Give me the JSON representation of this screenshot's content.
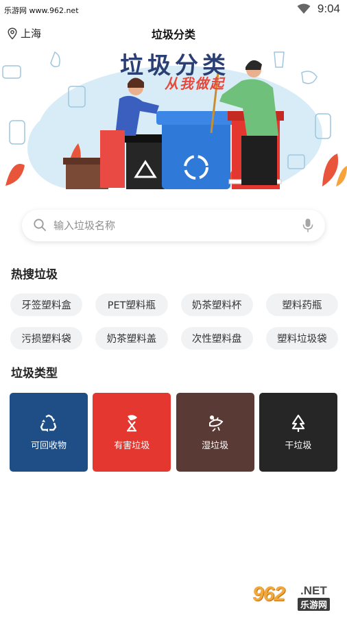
{
  "status_bar": {
    "site_text": "乐游网 www.962.net",
    "time": "9:04"
  },
  "header": {
    "location": "上海",
    "title": "垃圾分类"
  },
  "banner": {
    "title": "垃圾分类",
    "subtitle": "从我做起"
  },
  "search": {
    "placeholder": "输入垃圾名称",
    "value": ""
  },
  "hot": {
    "title": "热搜垃圾",
    "items": [
      "牙签塑料盒",
      "PET塑料瓶",
      "奶茶塑料杯",
      "塑料药瓶",
      "污损塑料袋",
      "奶茶塑料盖",
      "次性塑料盘",
      "塑料垃圾袋"
    ]
  },
  "types": {
    "title": "垃圾类型",
    "items": [
      {
        "label": "可回收物",
        "color": "#1f4e87",
        "icon": "recycle-icon"
      },
      {
        "label": "有害垃圾",
        "color": "#e4372f",
        "icon": "hazard-icon"
      },
      {
        "label": "湿垃圾",
        "color": "#5a3a34",
        "icon": "fish-bone-icon"
      },
      {
        "label": "干垃圾",
        "color": "#262626",
        "icon": "tree-icon"
      }
    ]
  },
  "watermark": {
    "main": "962",
    "net": ".NET",
    "sub": "乐游网"
  }
}
